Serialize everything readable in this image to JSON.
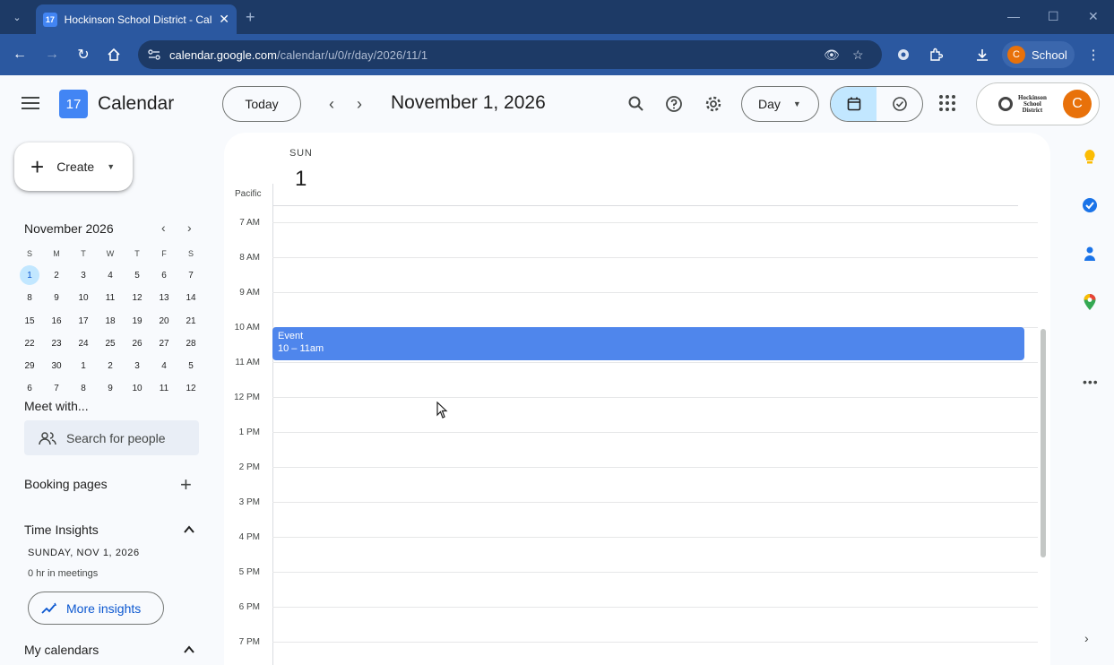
{
  "browser": {
    "tab_title": "Hockinson School District - Cal",
    "tab_favicon": "17",
    "address_host": "calendar.google.com",
    "address_path": "/calendar/u/0/r/day/2026/11/1",
    "profile_initial": "C",
    "profile_name": "School"
  },
  "header": {
    "logo_number": "17",
    "app_title": "Calendar",
    "today_label": "Today",
    "date_title": "November 1, 2026",
    "view_label": "Day",
    "org_name_lines": [
      "Hockinson",
      "School",
      "District"
    ],
    "avatar_initial": "C",
    "accent_color": "#0b57d0"
  },
  "sidebar": {
    "create_label": "Create",
    "mini_calendar": {
      "title": "November 2026",
      "weekday_heads": [
        "S",
        "M",
        "T",
        "W",
        "T",
        "F",
        "S"
      ],
      "weeks": [
        [
          "1",
          "2",
          "3",
          "4",
          "5",
          "6",
          "7"
        ],
        [
          "8",
          "9",
          "10",
          "11",
          "12",
          "13",
          "14"
        ],
        [
          "15",
          "16",
          "17",
          "18",
          "19",
          "20",
          "21"
        ],
        [
          "22",
          "23",
          "24",
          "25",
          "26",
          "27",
          "28"
        ],
        [
          "29",
          "30",
          "1",
          "2",
          "3",
          "4",
          "5"
        ],
        [
          "6",
          "7",
          "8",
          "9",
          "10",
          "11",
          "12"
        ]
      ],
      "selected": "1"
    },
    "meet_with_title": "Meet with...",
    "search_people_placeholder": "Search for people",
    "booking_pages_title": "Booking pages",
    "time_insights": {
      "title": "Time Insights",
      "date": "SUNDAY, NOV 1, 2026",
      "meetings": "0 hr in meetings",
      "more_label": "More insights"
    },
    "my_calendars_title": "My calendars"
  },
  "day_view": {
    "day_name": "SUN",
    "day_number": "1",
    "timezone": "Pacific",
    "hours": [
      "7 AM",
      "8 AM",
      "9 AM",
      "10 AM",
      "11 AM",
      "12 PM",
      "1 PM",
      "2 PM",
      "3 PM",
      "4 PM",
      "5 PM",
      "6 PM",
      "7 PM"
    ],
    "event": {
      "title": "Event",
      "time": "10 – 11am",
      "color": "#4f86ec"
    }
  },
  "side_panel": {
    "icons": [
      "keep-icon",
      "tasks-icon",
      "contacts-icon",
      "maps-icon"
    ]
  }
}
